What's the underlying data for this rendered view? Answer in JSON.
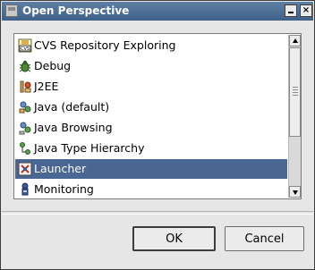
{
  "window": {
    "title": "Open Perspective",
    "close_glyph": "×"
  },
  "list": {
    "items": [
      {
        "label": "CVS Repository Exploring",
        "icon": "cvs-icon",
        "selected": false
      },
      {
        "label": "Debug",
        "icon": "debug-bug-icon",
        "selected": false
      },
      {
        "label": "J2EE",
        "icon": "j2ee-icon",
        "selected": false
      },
      {
        "label": "Java (default)",
        "icon": "java-perspective-icon",
        "selected": false
      },
      {
        "label": "Java Browsing",
        "icon": "java-browsing-icon",
        "selected": false
      },
      {
        "label": "Java Type Hierarchy",
        "icon": "type-hierarchy-icon",
        "selected": false
      },
      {
        "label": "Launcher",
        "icon": "launcher-icon",
        "selected": true
      },
      {
        "label": "Monitoring",
        "icon": "monitoring-icon",
        "selected": false
      }
    ]
  },
  "buttons": {
    "ok": "OK",
    "cancel": "Cancel"
  },
  "colors": {
    "selection": "#4a6692",
    "titlebar": "#4f7096"
  }
}
